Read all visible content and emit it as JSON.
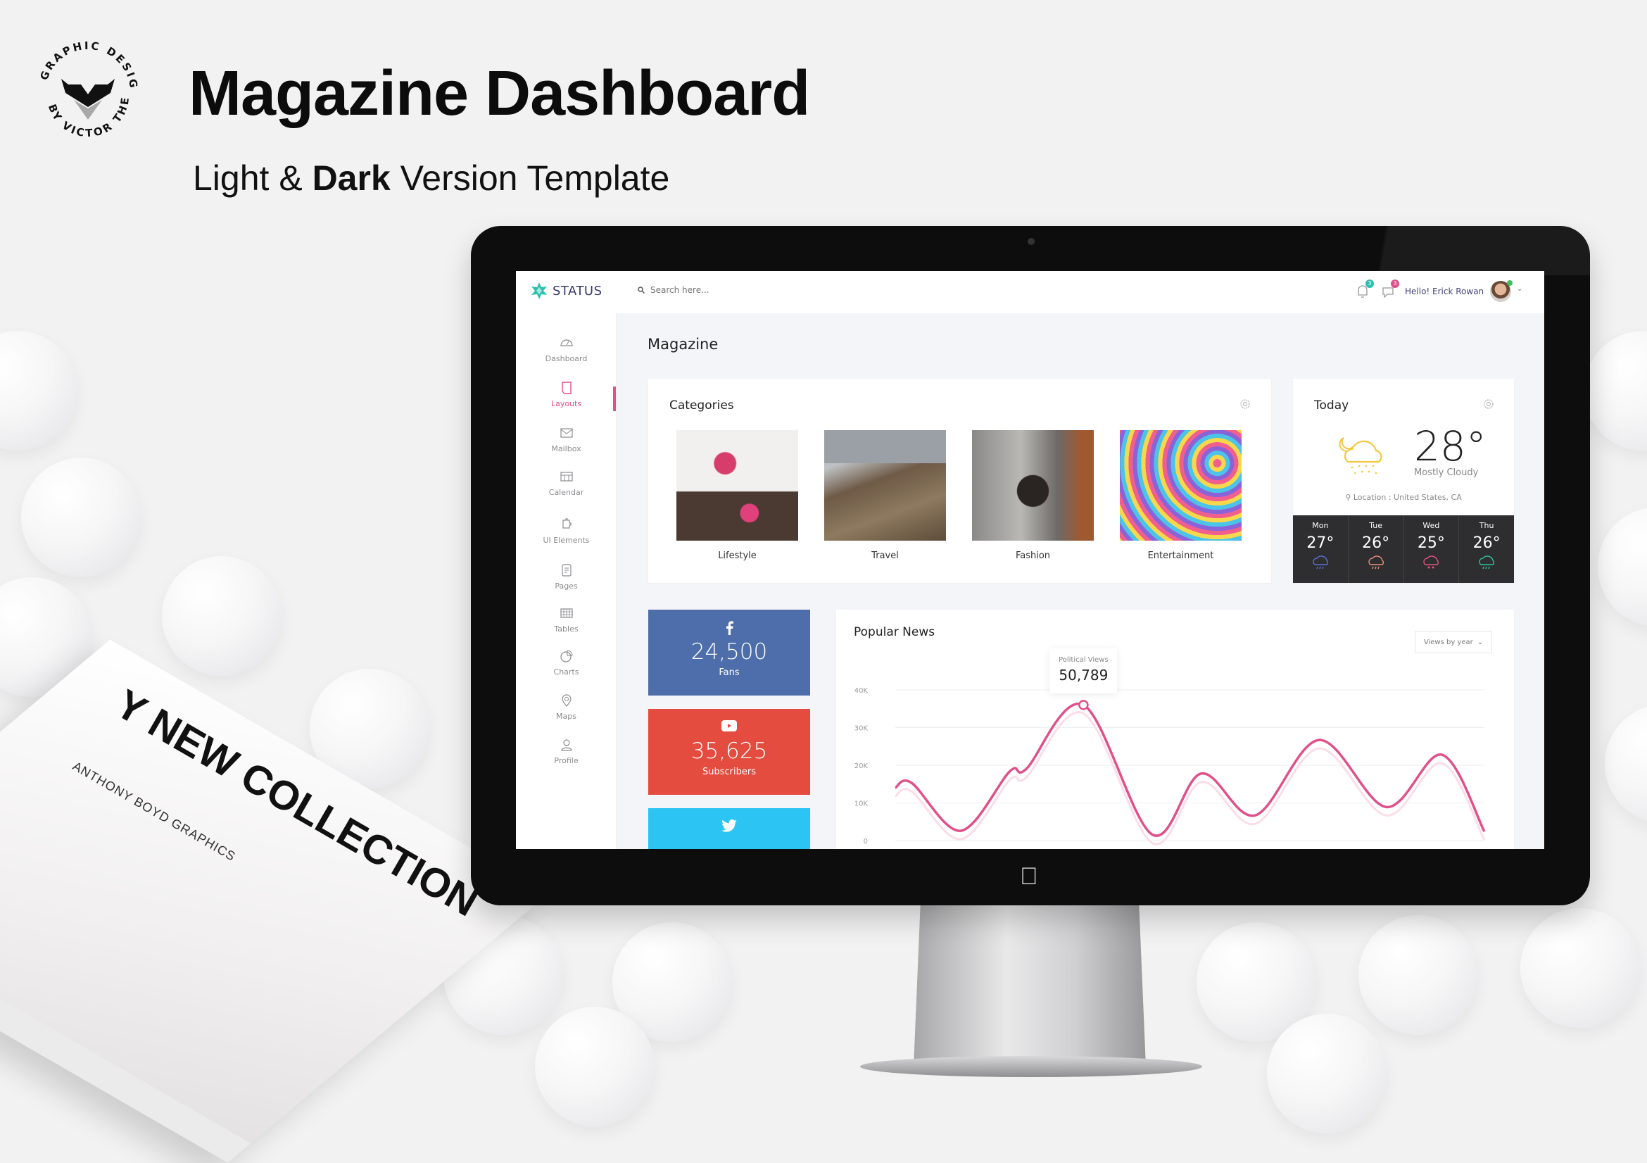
{
  "promo": {
    "title": "Magazine Dashboard",
    "subtitle_light": "Light &",
    "subtitle_bold": "Dark",
    "subtitle_rest": "Version Template",
    "logo_text_top": "GRAPHIC DESIGNS",
    "logo_text_bottom": "BY VICTOR THEMES",
    "book_title": "Y NEW COLLECTION",
    "book_subtitle": "ANTHONY BOYD GRAPHICS"
  },
  "app": {
    "brand": "STATUS",
    "search_placeholder": "Search here...",
    "notifications": [
      {
        "icon": "bell-icon",
        "count": "3",
        "color": "#2cc0b0"
      },
      {
        "icon": "chat-icon",
        "count": "3",
        "color": "#e0508a"
      }
    ],
    "greeting": "Hello! Erick Rowan",
    "accent": "#e0508a"
  },
  "sidebar": {
    "active": "Layouts",
    "items": [
      {
        "label": "Dashboard",
        "icon": "gauge-icon"
      },
      {
        "label": "Layouts",
        "icon": "layout-icon"
      },
      {
        "label": "Mailbox",
        "icon": "mail-icon"
      },
      {
        "label": "Calendar",
        "icon": "calendar-icon"
      },
      {
        "label": "UI Elements",
        "icon": "puzzle-icon"
      },
      {
        "label": "Pages",
        "icon": "page-icon"
      },
      {
        "label": "Tables",
        "icon": "table-icon"
      },
      {
        "label": "Charts",
        "icon": "pie-chart-icon"
      },
      {
        "label": "Maps",
        "icon": "map-pin-icon"
      },
      {
        "label": "Profile",
        "icon": "user-icon"
      }
    ]
  },
  "main": {
    "page_title": "Magazine",
    "categories": {
      "title": "Categories",
      "items": [
        {
          "label": "Lifestyle"
        },
        {
          "label": "Travel"
        },
        {
          "label": "Fashion"
        },
        {
          "label": "Entertainment"
        }
      ]
    },
    "weather": {
      "title": "Today",
      "temp": "28°",
      "condition": "Mostly Cloudy",
      "location": "Location : United States, CA",
      "forecast": [
        {
          "day": "Mon",
          "temp": "27°",
          "color": "#5a6fd6"
        },
        {
          "day": "Tue",
          "temp": "26°",
          "color": "#e8907a"
        },
        {
          "day": "Wed",
          "temp": "25°",
          "color": "#e2537f"
        },
        {
          "day": "Thu",
          "temp": "26°",
          "color": "#2fc2a0"
        }
      ]
    },
    "social": [
      {
        "network": "facebook",
        "value": "24,500",
        "label": "Fans",
        "color": "#4e6eab"
      },
      {
        "network": "youtube",
        "value": "35,625",
        "label": "Subscribers",
        "color": "#e34c3e"
      },
      {
        "network": "twitter",
        "value": "",
        "label": "",
        "color": "#2bc4f3"
      }
    ],
    "news": {
      "title": "Popular News",
      "select_value": "Views by year",
      "tooltip_label": "Political Views",
      "tooltip_value": "50,789"
    }
  },
  "chart_data": {
    "type": "line",
    "title": "Popular News",
    "xlabel": "",
    "ylabel": "",
    "ylim": [
      0,
      40000
    ],
    "y_ticks": [
      "0",
      "10K",
      "20K",
      "30K",
      "40K"
    ],
    "grid": true,
    "line_color": "#e0508a",
    "series": [
      {
        "x": [
          0,
          1,
          4,
          7,
          8,
          11.5,
          15.7,
          18.7,
          22,
          25.9,
          30,
          33.4,
          36
        ],
        "values": [
          14000,
          15300,
          2600,
          18400,
          19000,
          36000,
          1600,
          17800,
          6700,
          26700,
          8900,
          22800,
          2400
        ]
      }
    ],
    "highlight_index": 5
  }
}
